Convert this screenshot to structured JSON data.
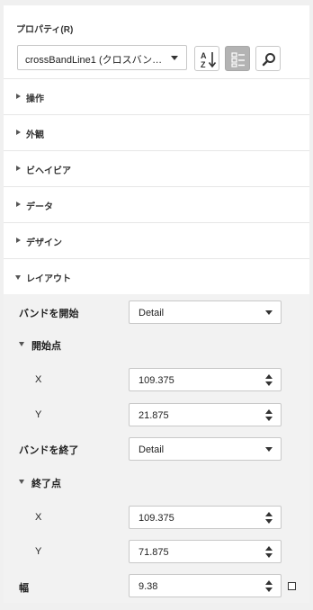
{
  "panel": {
    "title": "プロパティ(R)",
    "selected_object": "crossBandLine1 (クロスバン…"
  },
  "toolbar": {
    "sort_alpha_icon": "sort-alphabetical-icon",
    "categorized_icon": "categorized-view-icon",
    "search_icon": "search-icon"
  },
  "categories": [
    {
      "label": "操作",
      "expanded": false
    },
    {
      "label": "外観",
      "expanded": false
    },
    {
      "label": "ビヘイビア",
      "expanded": false
    },
    {
      "label": "データ",
      "expanded": false
    },
    {
      "label": "デザイン",
      "expanded": false
    },
    {
      "label": "レイアウト",
      "expanded": true
    }
  ],
  "layout": {
    "start_band": {
      "label": "バンドを開始",
      "value": "Detail"
    },
    "start_point": {
      "label": "開始点",
      "x": {
        "label": "X",
        "value": "109.375"
      },
      "y": {
        "label": "Y",
        "value": "21.875"
      }
    },
    "end_band": {
      "label": "バンドを終了",
      "value": "Detail"
    },
    "end_point": {
      "label": "終了点",
      "x": {
        "label": "X",
        "value": "109.375"
      },
      "y": {
        "label": "Y",
        "value": "71.875"
      }
    },
    "width": {
      "label": "幅",
      "value": "9.38",
      "checkbox_checked": false
    }
  },
  "colors": {
    "active_button": "#b3b3b3",
    "grid_background": "#f2f2f2",
    "page_background": "#f0f0f0"
  }
}
